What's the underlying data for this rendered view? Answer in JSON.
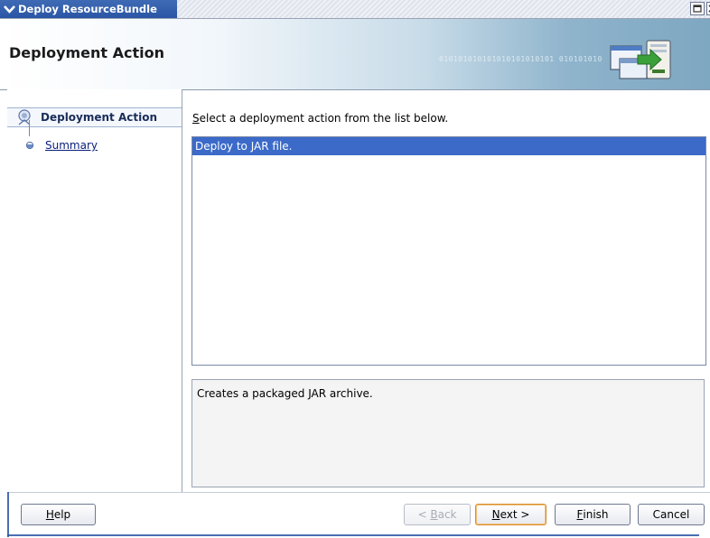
{
  "window": {
    "title": "Deploy ResourceBundle"
  },
  "banner": {
    "title": "Deployment Action",
    "binary_pattern": "010101010101010101010101 010101010"
  },
  "nav": {
    "items": [
      {
        "label": "Deployment Action",
        "state": "active"
      },
      {
        "label": "Summary",
        "state": "link"
      }
    ]
  },
  "content": {
    "instruction_mnemonic": "S",
    "instruction_rest": "elect a deployment action from the list below.",
    "actions": [
      {
        "label": "Deploy to JAR file.",
        "selected": true
      }
    ],
    "description": "Creates a packaged JAR archive."
  },
  "buttons": {
    "help": {
      "mnemonic": "H",
      "rest": "elp"
    },
    "back": {
      "prefix": "< ",
      "mnemonic": "B",
      "rest": "ack",
      "enabled": false
    },
    "next": {
      "mnemonic": "N",
      "rest": "ext >"
    },
    "finish": {
      "mnemonic": "F",
      "rest": "inish"
    },
    "cancel": {
      "label": "Cancel"
    }
  },
  "colors": {
    "selection": "#3b6ac9",
    "titlebar": "#2a55a5",
    "default_button_border": "#d88c2a"
  },
  "icons": [
    "menu-chevron-icon",
    "maximize-icon",
    "close-icon",
    "deploy-banner-icon",
    "active-step-icon",
    "step-icon"
  ]
}
